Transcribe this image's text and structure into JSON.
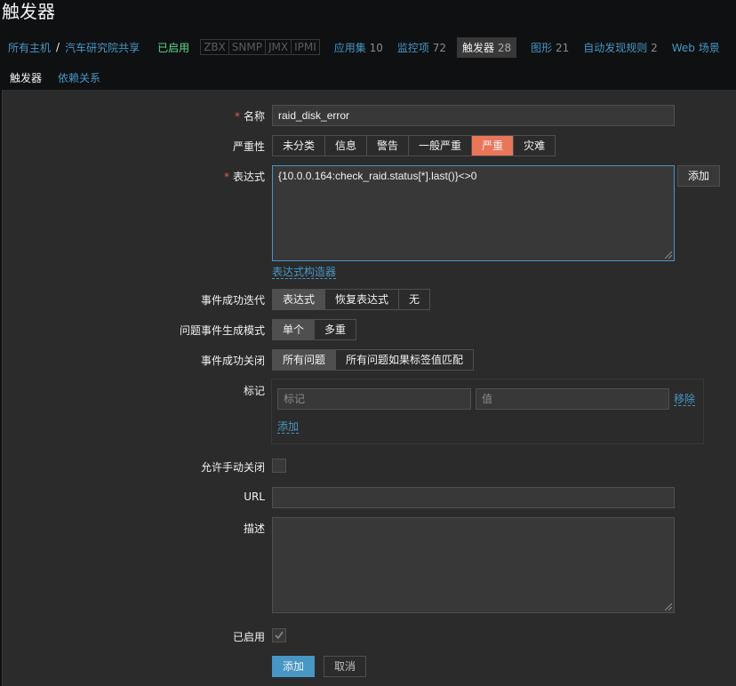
{
  "page": {
    "title": "触发器"
  },
  "nav": {
    "all_hosts": "所有主机",
    "separator": "/",
    "host": "汽车研究院共享",
    "status": "已启用",
    "protocols": [
      "ZBX",
      "SNMP",
      "JMX",
      "IPMI"
    ],
    "items": [
      {
        "label": "应用集",
        "count": "10"
      },
      {
        "label": "监控项",
        "count": "72"
      },
      {
        "label": "触发器",
        "count": "28"
      },
      {
        "label": "图形",
        "count": "21"
      },
      {
        "label": "自动发现规则",
        "count": "2"
      },
      {
        "label": "Web 场景",
        "count": ""
      }
    ]
  },
  "tabs": [
    "触发器",
    "依赖关系"
  ],
  "form": {
    "name": {
      "label": "名称",
      "value": "raid_disk_error"
    },
    "severity": {
      "label": "严重性",
      "options": [
        "未分类",
        "信息",
        "警告",
        "一般严重",
        "严重",
        "灾难"
      ],
      "selected": "严重"
    },
    "expression": {
      "label": "表达式",
      "value": "{10.0.0.164:check_raid.status[*].last()}<>0",
      "add_button": "添加",
      "builder_link": "表达式构造器"
    },
    "ok_event_generation": {
      "label": "事件成功迭代",
      "options": [
        "表达式",
        "恢复表达式",
        "无"
      ],
      "selected": "表达式"
    },
    "problem_event_mode": {
      "label": "问题事件生成模式",
      "options": [
        "单个",
        "多重"
      ],
      "selected": "单个"
    },
    "ok_event_closes": {
      "label": "事件成功关闭",
      "options": [
        "所有问题",
        "所有问题如果标签值匹配"
      ],
      "selected": "所有问题"
    },
    "tags": {
      "label": "标记",
      "tag_placeholder": "标记",
      "value_placeholder": "值",
      "remove": "移除",
      "add": "添加"
    },
    "allow_manual_close": {
      "label": "允许手动关闭",
      "checked": false
    },
    "url": {
      "label": "URL",
      "value": ""
    },
    "description": {
      "label": "描述",
      "value": ""
    },
    "enabled": {
      "label": "已启用",
      "checked": true
    },
    "buttons": {
      "submit": "添加",
      "cancel": "取消"
    }
  }
}
